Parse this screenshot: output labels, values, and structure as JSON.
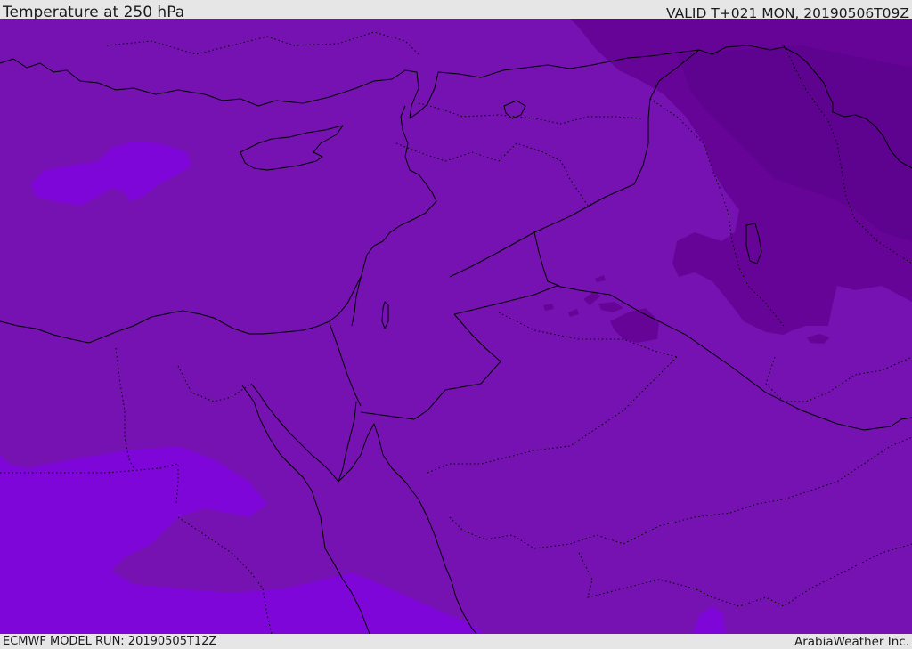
{
  "header": {
    "title": "Temperature at 250 hPa",
    "valid": "VALID T+021 MON, 20190506T09Z"
  },
  "footer": {
    "model_run": "ECMWF MODEL RUN: 20190505T12Z",
    "credit": "ArabiaWeather Inc."
  },
  "map": {
    "colors": {
      "base": "#7512b1",
      "warm": "#7e06d8",
      "cold": "#670498",
      "coldest": "#5e0290"
    }
  }
}
